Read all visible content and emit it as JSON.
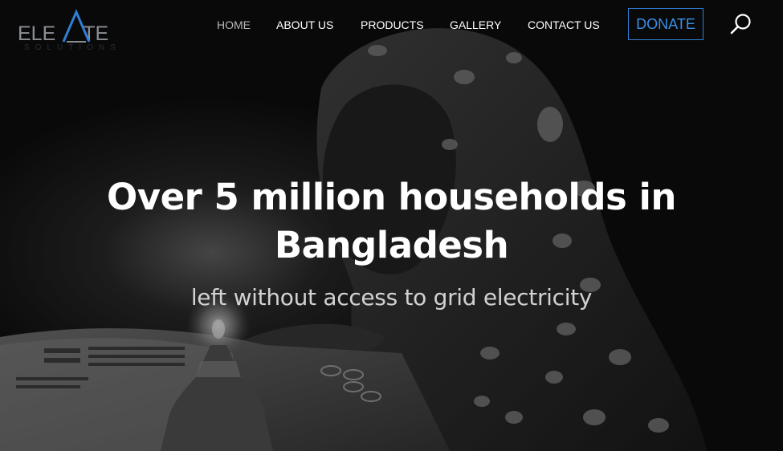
{
  "brand": {
    "logo_word_left": "ELE",
    "logo_word_right": "TE",
    "logo_sub": "SOLUTIONS",
    "logo_color": "#8b8f95",
    "logo_accent": "#2f7fd6"
  },
  "nav": {
    "items": [
      {
        "label": "HOME",
        "active": true
      },
      {
        "label": "ABOUT US",
        "active": false
      },
      {
        "label": "PRODUCTS",
        "active": false
      },
      {
        "label": "GALLERY",
        "active": false
      },
      {
        "label": "CONTACT US",
        "active": false
      }
    ],
    "donate_label": "DONATE",
    "search_icon": "search-icon"
  },
  "hero": {
    "headline_line1": "Over 5 million households in",
    "headline_line2": "Bangladesh",
    "subline": "left without access to grid electricity",
    "image_icon": "child-studying-by-lamp-photo"
  },
  "colors": {
    "accent": "#2f7fd6",
    "text": "#ffffff",
    "nav_active": "#b7b7b7",
    "background": "#0b0b0b"
  }
}
